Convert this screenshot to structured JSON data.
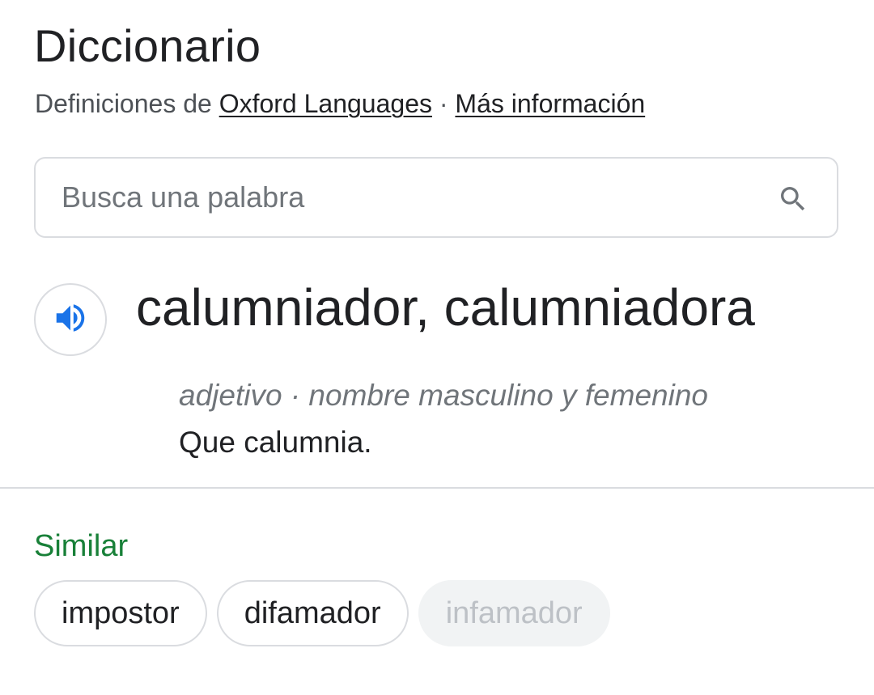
{
  "header": {
    "title": "Diccionario",
    "source_prefix": "Definiciones de ",
    "source_link": "Oxford Languages",
    "separator": " · ",
    "more_info_link": "Más información"
  },
  "search": {
    "placeholder": "Busca una palabra",
    "value": "",
    "icon": "search-icon"
  },
  "entry": {
    "speaker_icon": "speaker-icon",
    "headword": "calumniador, calumniadora",
    "part_of_speech": "adjetivo · nombre masculino y femenino",
    "definition": "Que calumnia."
  },
  "similar": {
    "label": "Similar",
    "chips": [
      {
        "label": "impostor",
        "faded": false
      },
      {
        "label": "difamador",
        "faded": false
      },
      {
        "label": "infamador",
        "faded": true
      }
    ]
  },
  "colors": {
    "accent_blue": "#1a73e8",
    "similar_green": "#188038",
    "border": "#dadce0",
    "text_secondary": "#70757a"
  }
}
